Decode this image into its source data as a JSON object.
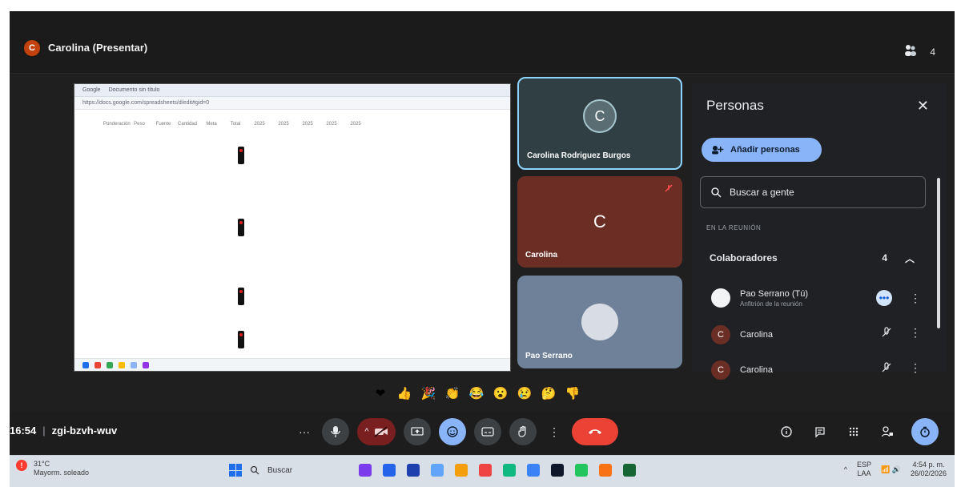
{
  "presenter": {
    "initial": "C",
    "title": "Carolina (Presentar)",
    "top_count": "4"
  },
  "shared_screen": {
    "browser_tabs": [
      "Google",
      "Documento sin título"
    ],
    "url": "https://docs.google.com/spreadsheets/d/edit#gid=0",
    "sheet_headers": [
      "Ponderación",
      "Peso",
      "Fuente",
      "Cantidad",
      "Meta",
      "Total",
      "2025",
      "2025",
      "2025",
      "2025",
      "2025"
    ]
  },
  "tiles": {
    "tile1": {
      "name": "Carolina Rodriguez Burgos",
      "initial": "C"
    },
    "tile2": {
      "name": "Carolina",
      "initial": "C"
    },
    "tile3": {
      "name": "Pao Serrano",
      "initial": ""
    }
  },
  "people_panel": {
    "title": "Personas",
    "add_people": "Añadir personas",
    "search_placeholder": "Buscar a gente",
    "section_label": "EN LA REUNIÓN",
    "group": {
      "label": "Colaboradores",
      "count": "4"
    },
    "people": [
      {
        "name": "Pao Serrano (Tú)",
        "sub": "Anfitrión de la reunión",
        "initial": "",
        "avatar_color": "#f1f3f4"
      },
      {
        "name": "Carolina",
        "sub": "",
        "initial": "C",
        "avatar_color": "#6b2e25"
      },
      {
        "name": "Carolina",
        "sub": "",
        "initial": "C",
        "avatar_color": "#6b2e25"
      }
    ]
  },
  "reactions": [
    "❤",
    "👍",
    "🎉",
    "👏",
    "😂",
    "😮",
    "😢",
    "🤔",
    "👎"
  ],
  "bottom": {
    "time": "16:54",
    "meeting_code": "zgi-bzvh-wuv"
  },
  "taskbar": {
    "weather_temp": "31°C",
    "weather_desc": "Mayorm. soleado",
    "search_label": "Buscar",
    "lang_top": "ESP",
    "lang_bottom": "LAA",
    "time": "4:54 p. m.",
    "date": "26/02/2026"
  }
}
